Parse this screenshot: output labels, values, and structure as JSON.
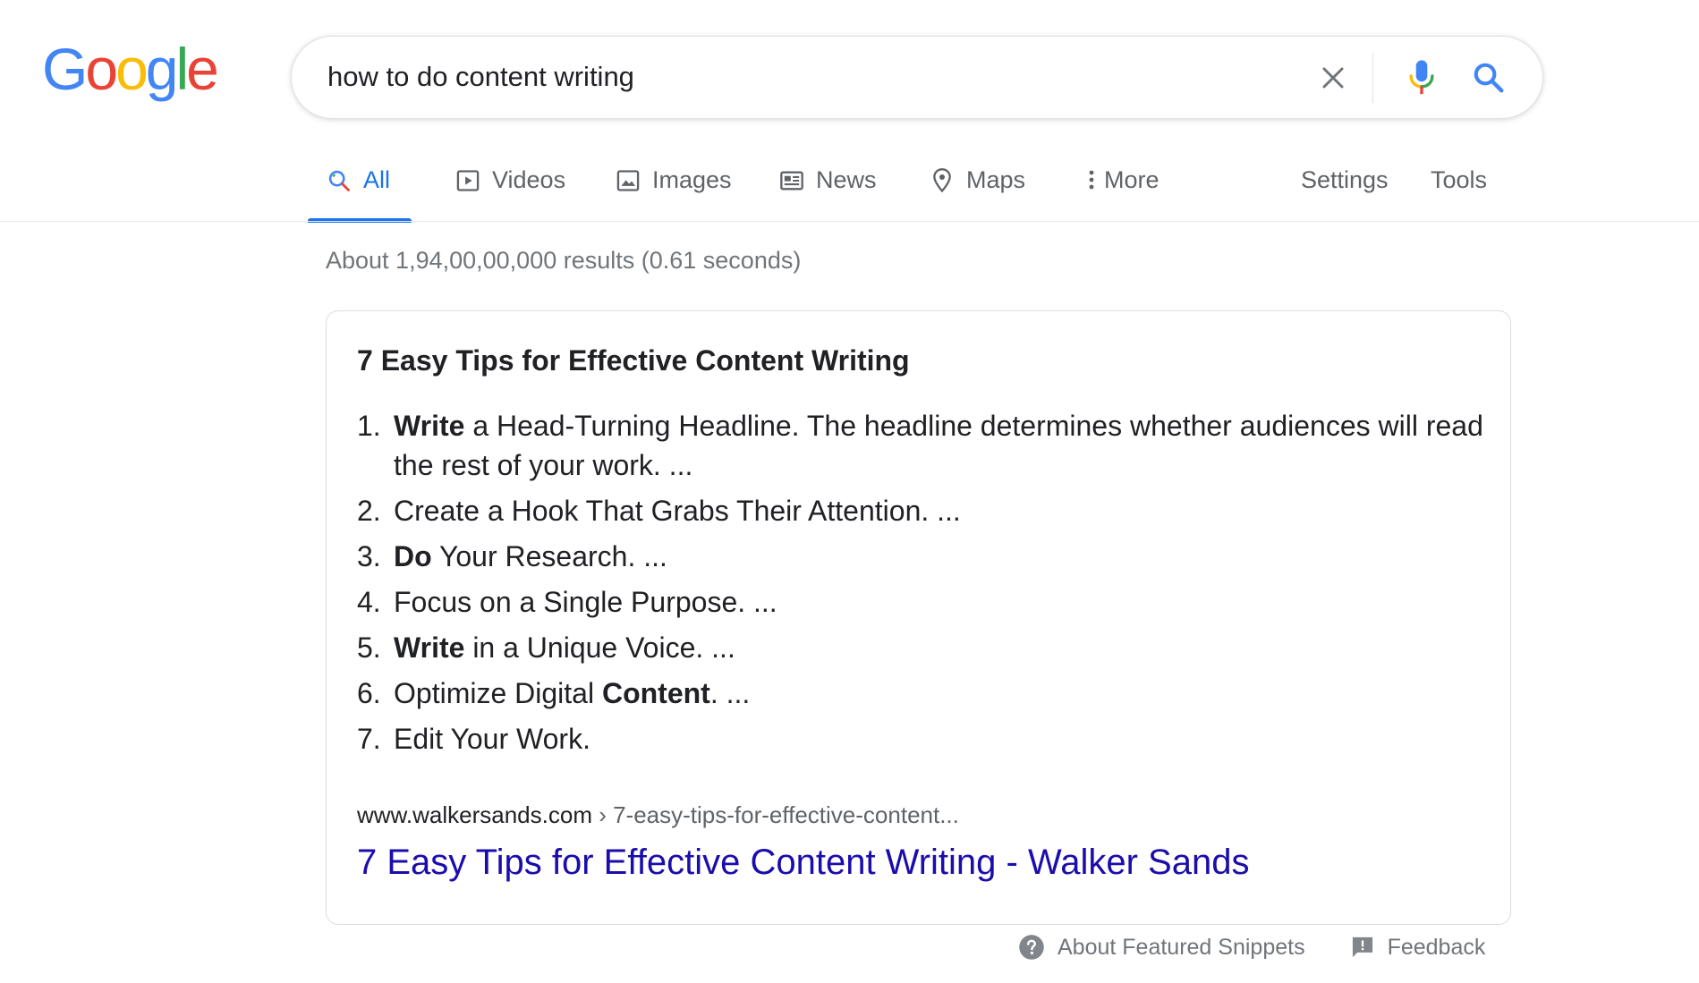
{
  "logo": {
    "letters": [
      {
        "char": "G",
        "color": "#4285F4"
      },
      {
        "char": "o",
        "color": "#EA4335"
      },
      {
        "char": "o",
        "color": "#FBBC05"
      },
      {
        "char": "g",
        "color": "#4285F4"
      },
      {
        "char": "l",
        "color": "#34A853"
      },
      {
        "char": "e",
        "color": "#EA4335"
      }
    ]
  },
  "search": {
    "query": "how to do content writing",
    "icons": {
      "clear": "close-icon",
      "voice": "mic-icon",
      "submit": "search-icon"
    }
  },
  "tabs": [
    {
      "label": "All",
      "icon": "search-icon",
      "active": true
    },
    {
      "label": "Videos",
      "icon": "video-play-icon"
    },
    {
      "label": "Images",
      "icon": "image-icon"
    },
    {
      "label": "News",
      "icon": "newspaper-icon"
    },
    {
      "label": "Maps",
      "icon": "map-pin-icon"
    },
    {
      "label": "More",
      "icon": "more-vert-icon"
    }
  ],
  "tools": {
    "settings": "Settings",
    "tools": "Tools"
  },
  "result_stats": "About 1,94,00,00,000 results (0.61 seconds)",
  "featured_snippet": {
    "title": "7 Easy Tips for Effective Content Writing",
    "items": [
      {
        "num": "1.",
        "parts": [
          {
            "text": "Write",
            "bold": true
          },
          {
            "text": " a Head-Turning Headline. The headline determines whether audiences will read the rest of your work. ..."
          }
        ]
      },
      {
        "num": "2.",
        "parts": [
          {
            "text": "Create a Hook That Grabs Their Attention. ..."
          }
        ]
      },
      {
        "num": "3.",
        "parts": [
          {
            "text": "Do",
            "bold": true
          },
          {
            "text": " Your Research. ..."
          }
        ]
      },
      {
        "num": "4.",
        "parts": [
          {
            "text": "Focus on a Single Purpose. ..."
          }
        ]
      },
      {
        "num": "5.",
        "parts": [
          {
            "text": "Write",
            "bold": true
          },
          {
            "text": " in a Unique Voice. ..."
          }
        ]
      },
      {
        "num": "6.",
        "parts": [
          {
            "text": "Optimize Digital "
          },
          {
            "text": "Content",
            "bold": true
          },
          {
            "text": ". ..."
          }
        ]
      },
      {
        "num": "7.",
        "parts": [
          {
            "text": "Edit Your Work."
          }
        ]
      }
    ],
    "cite_domain": "www.walkersands.com",
    "cite_path": " › 7-easy-tips-for-effective-content...",
    "link_title": "7 Easy Tips for Effective Content Writing - Walker Sands"
  },
  "snippet_footer": {
    "about": "About Featured Snippets",
    "feedback": "Feedback"
  },
  "colors": {
    "accent": "#1a73e8",
    "link": "#1a0dab",
    "muted": "#70757a"
  }
}
